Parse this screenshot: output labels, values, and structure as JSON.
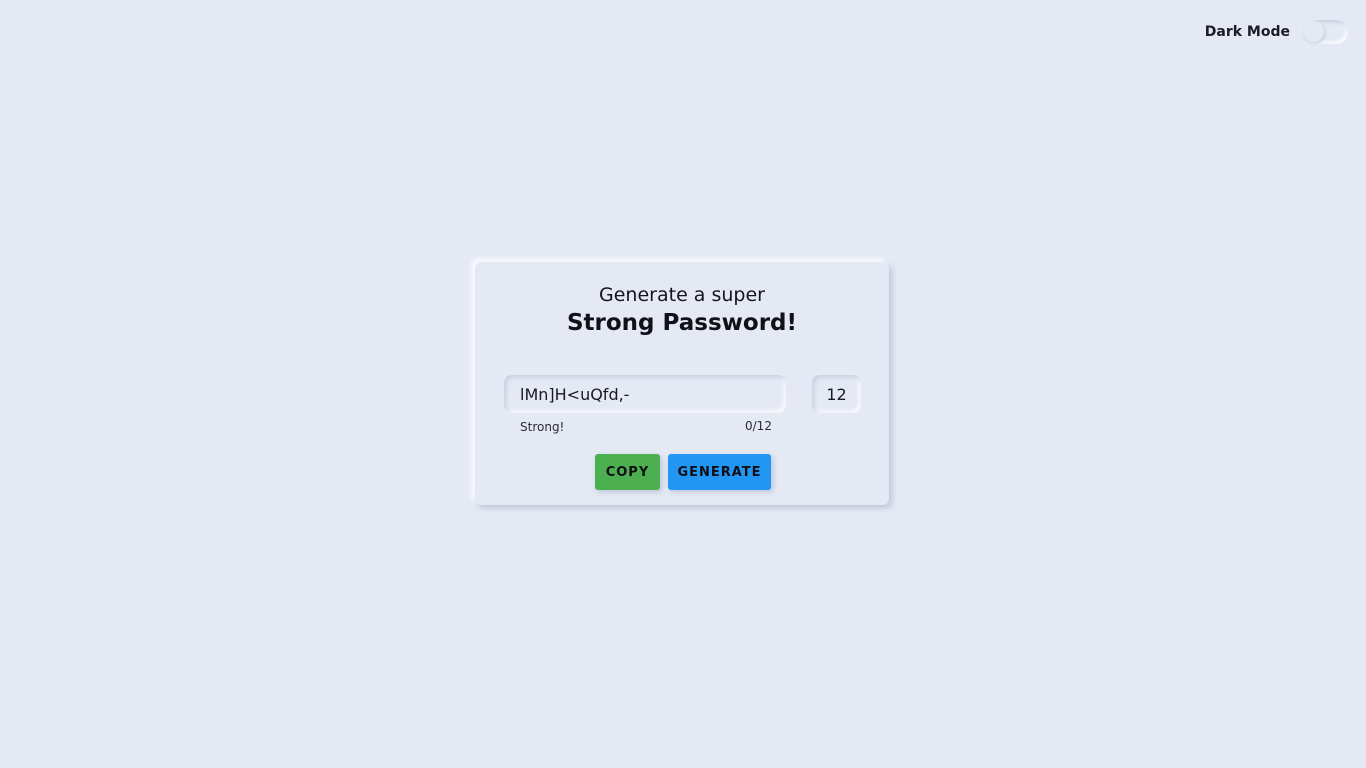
{
  "header": {
    "dark_mode_label": "Dark Mode",
    "dark_mode_enabled": false
  },
  "card": {
    "subtitle": "Generate a super",
    "title": "Strong Password!",
    "password_value": "lMn]H<uQfd,-",
    "length_value": "12",
    "strength_text": "Strong!",
    "counter_text": "0/12",
    "copy_label": "COPY",
    "generate_label": "GENERATE"
  },
  "colors": {
    "background": "#e4e9f3",
    "copy_button": "#4caf50",
    "generate_button": "#2196f3"
  }
}
